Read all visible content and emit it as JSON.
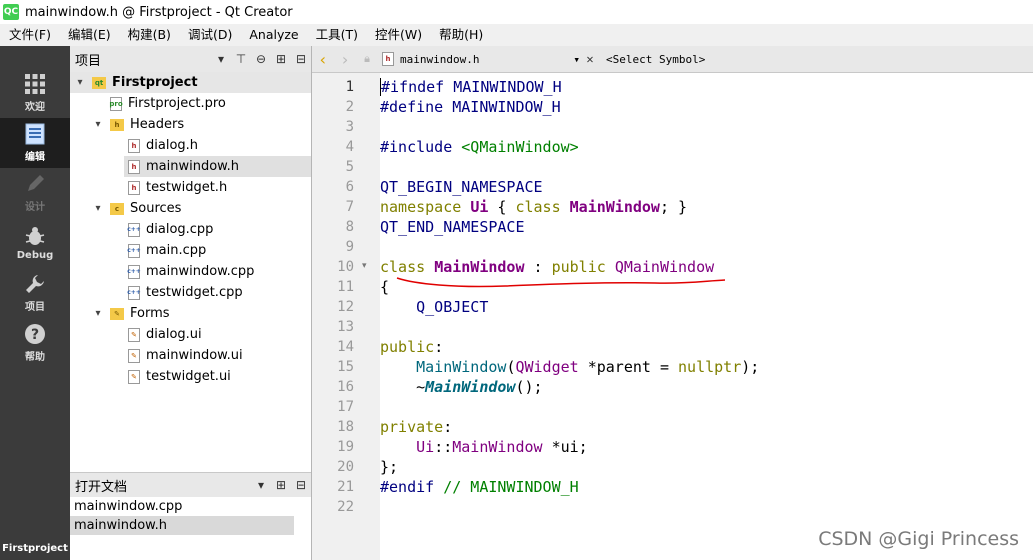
{
  "window": {
    "title": "mainwindow.h @ Firstproject - Qt Creator",
    "logo": "QC"
  },
  "menu": [
    "文件(F)",
    "编辑(E)",
    "构建(B)",
    "调试(D)",
    "Analyze",
    "工具(T)",
    "控件(W)",
    "帮助(H)"
  ],
  "modes": [
    {
      "label": "欢迎",
      "icon": "grid-icon"
    },
    {
      "label": "编辑",
      "icon": "edit-doc-icon"
    },
    {
      "label": "设计",
      "icon": "pencil-icon"
    },
    {
      "label": "Debug",
      "icon": "bug-icon"
    },
    {
      "label": "项目",
      "icon": "wrench-icon"
    },
    {
      "label": "帮助",
      "icon": "help-icon"
    }
  ],
  "mode_footer": "Firstproject",
  "project_pane": {
    "title": "项目",
    "tree": {
      "project": "Firstproject",
      "pro_file": "Firstproject.pro",
      "headers": {
        "label": "Headers",
        "files": [
          "dialog.h",
          "mainwindow.h",
          "testwidget.h"
        ]
      },
      "sources": {
        "label": "Sources",
        "files": [
          "dialog.cpp",
          "main.cpp",
          "mainwindow.cpp",
          "testwidget.cpp"
        ]
      },
      "forms": {
        "label": "Forms",
        "files": [
          "dialog.ui",
          "mainwindow.ui",
          "testwidget.ui"
        ]
      }
    }
  },
  "open_docs": {
    "title": "打开文档",
    "files": [
      "mainwindow.cpp",
      "mainwindow.h"
    ]
  },
  "editor": {
    "current_file": "mainwindow.h",
    "symbol": "<Select Symbol>",
    "line_numbers": [
      "1",
      "2",
      "3",
      "4",
      "5",
      "6",
      "7",
      "8",
      "9",
      "10",
      "11",
      "12",
      "13",
      "14",
      "15",
      "16",
      "17",
      "18",
      "19",
      "20",
      "21",
      "22"
    ]
  },
  "watermark": "CSDN @Gigi Princess",
  "colors": {
    "keyword": "#808000",
    "type": "#800080",
    "preprocessor": "#000080",
    "string": "#008000",
    "function": "#00677c",
    "annotation": "#e00000"
  }
}
